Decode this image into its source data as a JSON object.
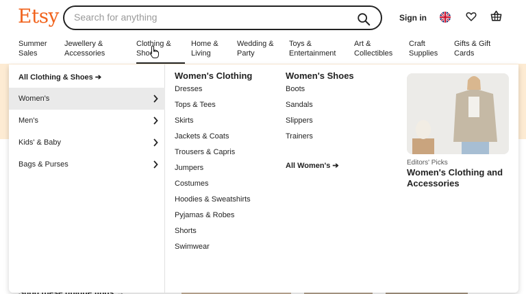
{
  "header": {
    "logo": "Etsy",
    "search_placeholder": "Search for anything",
    "signin_label": "Sign in"
  },
  "nav": {
    "items": [
      {
        "line1": "Summer",
        "line2": "Sales"
      },
      {
        "line1": "Jewellery &",
        "line2": "Accessories"
      },
      {
        "line1": "Clothing &",
        "line2": "Shoes"
      },
      {
        "line1": "Home &",
        "line2": "Living"
      },
      {
        "line1": "Wedding &",
        "line2": "Party"
      },
      {
        "line1": "Toys &",
        "line2": "Entertainment"
      },
      {
        "line1": "Art &",
        "line2": "Collectibles"
      },
      {
        "line1": "Craft",
        "line2": "Supplies"
      },
      {
        "line1": "Gifts & Gift",
        "line2": "Cards"
      }
    ]
  },
  "dropdown": {
    "all_link": "All Clothing & Shoes",
    "sidebar": [
      {
        "label": "Women's"
      },
      {
        "label": "Men's"
      },
      {
        "label": "Kids' & Baby"
      },
      {
        "label": "Bags & Purses"
      }
    ],
    "womens_clothing": {
      "title": "Women's Clothing",
      "links": [
        "Dresses",
        "Tops & Tees",
        "Skirts",
        "Jackets & Coats",
        "Trousers & Capris",
        "Jumpers",
        "Costumes",
        "Hoodies & Sweatshirts",
        "Pyjamas & Robes",
        "Shorts",
        "Swimwear"
      ]
    },
    "womens_shoes": {
      "title": "Women's Shoes",
      "links": [
        "Boots",
        "Sandals",
        "Slippers",
        "Trainers"
      ]
    },
    "all_women": "All Women's",
    "promo": {
      "kicker": "Editors' Picks",
      "title": "Women's Clothing and Accessories"
    }
  },
  "page": {
    "bottom_text": "Shop these unique finds"
  },
  "colors": {
    "brand": "#f1641e",
    "band": "#fdebd3",
    "active_row": "#eaeaea"
  }
}
